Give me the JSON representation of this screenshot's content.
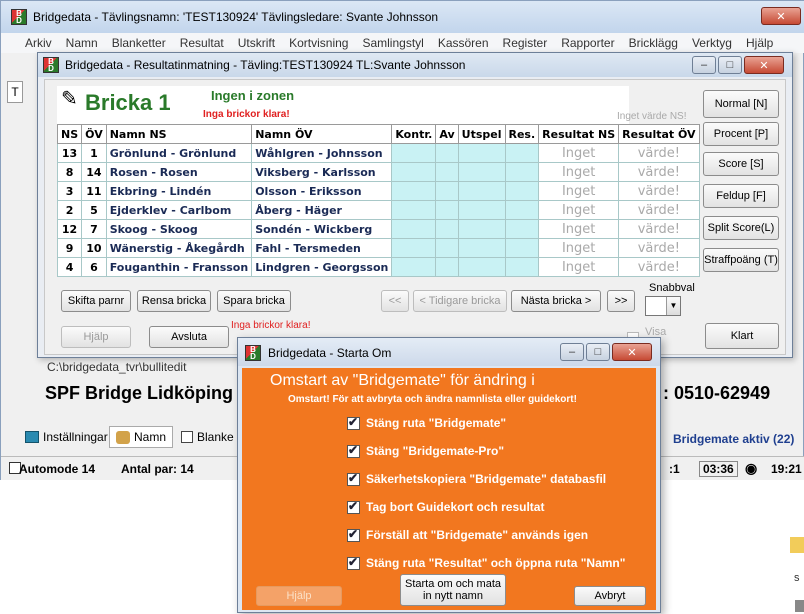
{
  "main_window": {
    "title": "Bridgedata - Tävlingsnamn: 'TEST130924' Tävlingsledare: Svante Johnsson",
    "menu": [
      "Arkiv",
      "Namn",
      "Blanketter",
      "Resultat",
      "Utskrift",
      "Kortvisning",
      "Samlingstyl",
      "Kassören",
      "Register",
      "Rapporter",
      "Bricklägg",
      "Verktyg",
      "Hjälp"
    ],
    "path": "C:\\bridgedata_tvr\\bullitedit",
    "club_title": "SPF Bridge Lidköping",
    "phone": ": 0510-62949",
    "tabs": [
      "Inställningar",
      "Namn",
      "Blanke"
    ],
    "bridgemate_status": "Bridgemate aktiv (22)",
    "status_automode": "Automode 14",
    "status_pairs": "Antal par: 14",
    "status_round": ":1",
    "status_time1": "03:36",
    "status_time2": "19:21",
    "left_letter": "T",
    "right_sep_num": "s"
  },
  "result_window": {
    "title": "Bridgedata - Resultatinmatning - Tävling:TEST130924 TL:Svante Johnsson",
    "board_label": "Bricka 1",
    "zone": "Ingen i zonen",
    "no_boards_ready": "Inga brickor klara!",
    "no_value_ns": "Inget värde NS!",
    "columns": [
      "NS",
      "ÖV",
      "Namn NS",
      "Namn ÖV",
      "Kontr.",
      "Av",
      "Utspel",
      "Res.",
      "Resultat NS",
      "Resultat ÖV"
    ],
    "rows": [
      {
        "ns": "13",
        "ov": "1",
        "namn_ns": "Grönlund - Grönlund",
        "namn_ov": "Wåhlgren - Johnsson",
        "res_ns": "Inget",
        "res_ov": "värde!"
      },
      {
        "ns": "8",
        "ov": "14",
        "namn_ns": "Rosen - Rosen",
        "namn_ov": "Viksberg - Karlsson",
        "res_ns": "Inget",
        "res_ov": "värde!"
      },
      {
        "ns": "3",
        "ov": "11",
        "namn_ns": "Ekbring - Lindén",
        "namn_ov": "Olsson - Eriksson",
        "res_ns": "Inget",
        "res_ov": "värde!"
      },
      {
        "ns": "2",
        "ov": "5",
        "namn_ns": "Ejderklev - Carlbom",
        "namn_ov": "Åberg - Häger",
        "res_ns": "Inget",
        "res_ov": "värde!"
      },
      {
        "ns": "12",
        "ov": "7",
        "namn_ns": "Skoog - Skoog",
        "namn_ov": "Sondén - Wickberg",
        "res_ns": "Inget",
        "res_ov": "värde!"
      },
      {
        "ns": "9",
        "ov": "10",
        "namn_ns": "Wänerstig - Åkegårdh",
        "namn_ov": "Fahl - Tersmeden",
        "res_ns": "Inget",
        "res_ov": "värde!"
      },
      {
        "ns": "4",
        "ov": "6",
        "namn_ns": "Fouganthin - Fransson",
        "namn_ov": "Lindgren - Georgsson",
        "res_ns": "Inget",
        "res_ov": "värde!"
      }
    ],
    "side_buttons": [
      "Normal [N]",
      "Procent [P]",
      "Score [S]",
      "Feldup [F]",
      "Split Score(L)",
      "Straffpoäng (T)"
    ],
    "btn_shift_pair": "Skifta parnr",
    "btn_clear_board": "Rensa bricka",
    "btn_save_board": "Spara bricka",
    "btn_first": "<<",
    "btn_prev": "< Tidigare bricka",
    "btn_next": "Nästa bricka >",
    "btn_last": ">>",
    "quick_select_label": "Snabbval",
    "btn_help": "Hjälp",
    "btn_exit": "Avsluta",
    "status_no_boards": "Inga brickor klara!",
    "show_label": "Visa",
    "btn_done": "Klart"
  },
  "restart_dialog": {
    "title": "Bridgedata - Starta Om",
    "heading": "Omstart av \"Bridgemate\" för ändring i",
    "subheading": "Omstart! För att avbryta och ändra namnlista eller guidekort!",
    "items": [
      "Stäng ruta \"Bridgemate\"",
      "Stäng \"Bridgemate-Pro\"",
      "Säkerhetskopiera \"Bridgemate\" databasfil",
      "Tag bort Guidekort och resultat",
      "Förställ att \"Bridgemate\" används igen",
      "Stäng ruta \"Resultat\" och öppna ruta \"Namn\""
    ],
    "btn_help": "Hjälp",
    "btn_restart": "Starta om och mata in nytt namn",
    "btn_cancel": "Avbryt"
  },
  "colors": {
    "orange": "#f2771f",
    "cyan_cell": "#c9f2f4",
    "red_text": "#e02020",
    "green_text": "#2a7a2a",
    "blue_text": "#1f3f8f"
  }
}
